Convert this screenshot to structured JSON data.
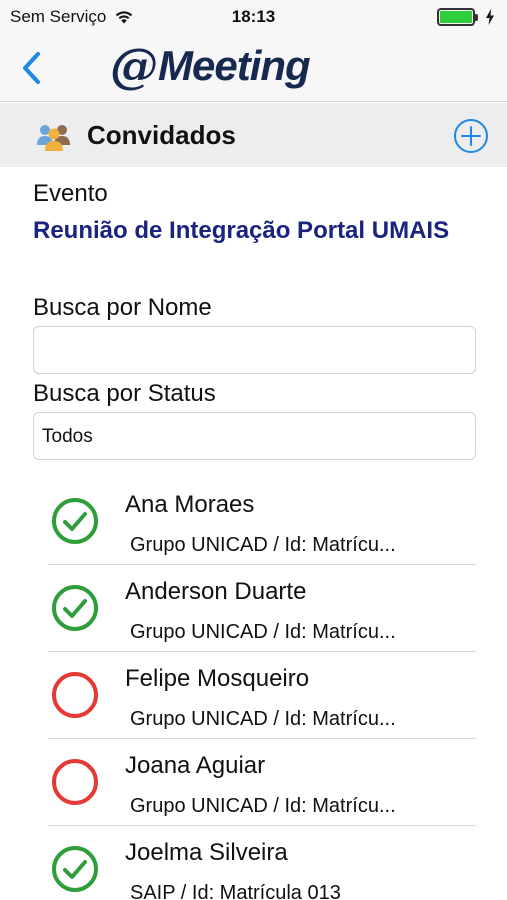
{
  "status_bar": {
    "carrier": "Sem Serviço",
    "time": "18:13",
    "wifi_icon": "wifi-icon",
    "battery_icon": "battery-icon",
    "charging_icon": "charging-bolt-icon"
  },
  "nav": {
    "back_icon": "chevron-left-icon",
    "logo_at": "@",
    "logo_text": "Meeting"
  },
  "header": {
    "icon": "people-group-icon",
    "title": "Convidados",
    "add_icon": "plus-circle-icon"
  },
  "form": {
    "event_label": "Evento",
    "event_name": "Reunião de Integração Portal UMAIS",
    "name_search_label": "Busca por Nome",
    "name_search_value": "",
    "status_search_label": "Busca por Status",
    "status_search_value": "Todos"
  },
  "guests": [
    {
      "name": "Ana Moraes",
      "detail": "Grupo UNICAD / Id: Matrícu...",
      "status": "confirmed",
      "status_icon": "check-circle-icon"
    },
    {
      "name": "Anderson Duarte",
      "detail": "Grupo UNICAD / Id: Matrícu...",
      "status": "confirmed",
      "status_icon": "check-circle-icon"
    },
    {
      "name": "Felipe Mosqueiro",
      "detail": "Grupo UNICAD / Id: Matrícu...",
      "status": "pending",
      "status_icon": "empty-circle-icon"
    },
    {
      "name": "Joana Aguiar",
      "detail": "Grupo UNICAD / Id: Matrícu...",
      "status": "pending",
      "status_icon": "empty-circle-icon"
    },
    {
      "name": "Joelma Silveira",
      "detail": "SAIP / Id: Matrícula 013",
      "status": "confirmed",
      "status_icon": "check-circle-icon"
    }
  ],
  "colors": {
    "accent": "#1e88e5",
    "event_name": "#1a237e",
    "confirmed": "#2e9e3a",
    "pending": "#e53935",
    "logo": "#16294f"
  }
}
